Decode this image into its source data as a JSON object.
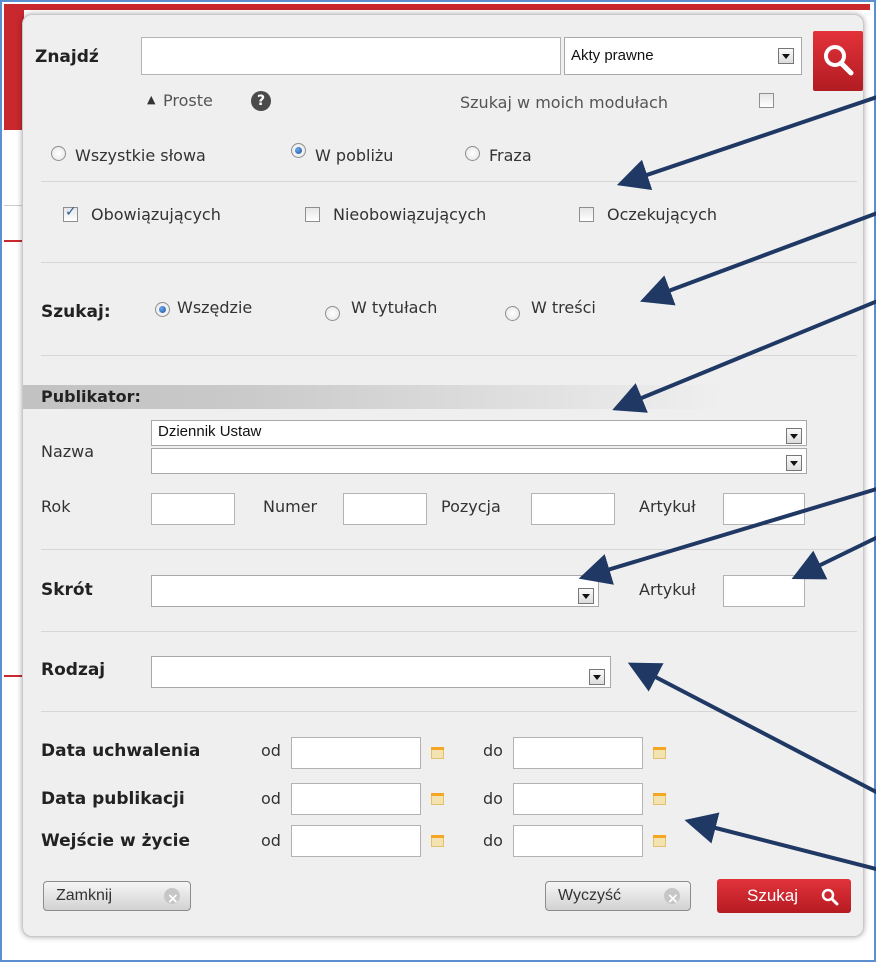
{
  "search": {
    "label": "Znajdź",
    "category_value": "Akty prawne",
    "simple_toggle": "Proste",
    "help_glyph": "?",
    "search_in_modules": "Szukaj w moich modułach"
  },
  "word_mode": {
    "options": [
      "Wszystkie słowa",
      "W pobliżu",
      "Fraza"
    ],
    "selected": "W pobliżu"
  },
  "status": {
    "options": [
      "Obowiązujących",
      "Nieobowiązujących",
      "Oczekujących"
    ],
    "checked": [
      "Obowiązujących"
    ]
  },
  "scope": {
    "label": "Szukaj:",
    "options": [
      "Wszędzie",
      "W tytułach",
      "W treści"
    ],
    "selected": "Wszędzie"
  },
  "publikator": {
    "header": "Publikator:",
    "name_label": "Nazwa",
    "name_value": "Dziennik Ustaw",
    "name_value2": "",
    "rok_label": "Rok",
    "numer_label": "Numer",
    "pozycja_label": "Pozycja",
    "artykul_label": "Artykuł"
  },
  "skrot": {
    "label": "Skrót",
    "artykul_label": "Artykuł"
  },
  "rodzaj": {
    "label": "Rodzaj"
  },
  "dates": {
    "from_label": "od",
    "to_label": "do",
    "rows": [
      "Data uchwalenia",
      "Data publikacji",
      "Wejście w życie"
    ]
  },
  "buttons": {
    "close": "Zamknij",
    "clear": "Wyczyść",
    "search": "Szukaj"
  },
  "colors": {
    "accent_red": "#c8282e",
    "arrow_navy": "#1f3864",
    "frame_blue": "#5b8fd0"
  }
}
